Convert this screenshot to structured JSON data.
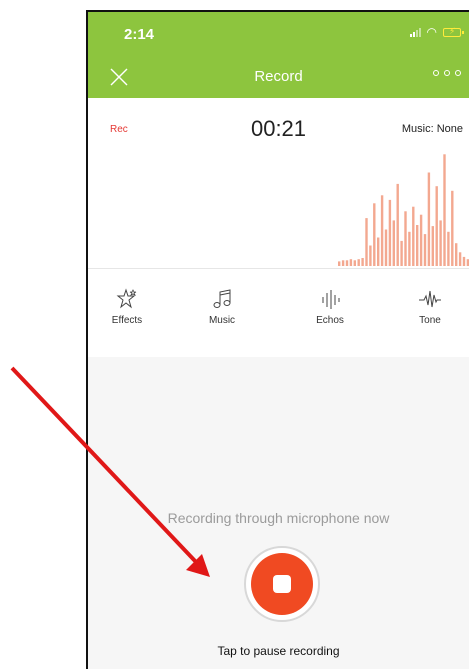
{
  "status_bar": {
    "time": "2:14"
  },
  "nav": {
    "title": "Record"
  },
  "recorder": {
    "rec_label": "Rec",
    "elapsed": "00:21",
    "music_label": "Music: None",
    "waveform_levels": [
      0.04,
      0.05,
      0.05,
      0.06,
      0.05,
      0.06,
      0.07,
      0.42,
      0.18,
      0.55,
      0.25,
      0.62,
      0.32,
      0.58,
      0.4,
      0.72,
      0.22,
      0.48,
      0.3,
      0.52,
      0.36,
      0.45,
      0.28,
      0.82,
      0.35,
      0.7,
      0.4,
      0.98,
      0.3,
      0.66,
      0.2,
      0.12,
      0.08,
      0.06
    ]
  },
  "tools": [
    {
      "label": "Effects",
      "icon": "star-sparkle-icon"
    },
    {
      "label": "Music",
      "icon": "music-note-icon"
    },
    {
      "label": "Echos",
      "icon": "echo-bars-icon"
    },
    {
      "label": "Tone",
      "icon": "tone-wave-icon"
    }
  ],
  "hint_text": "Recording through microphone now",
  "pause_hint": "Tap to pause recording",
  "colors": {
    "header": "#8dc53e",
    "record_button": "#f04a22",
    "waveform": "#f3a890",
    "annotation_arrow": "#e01818"
  }
}
